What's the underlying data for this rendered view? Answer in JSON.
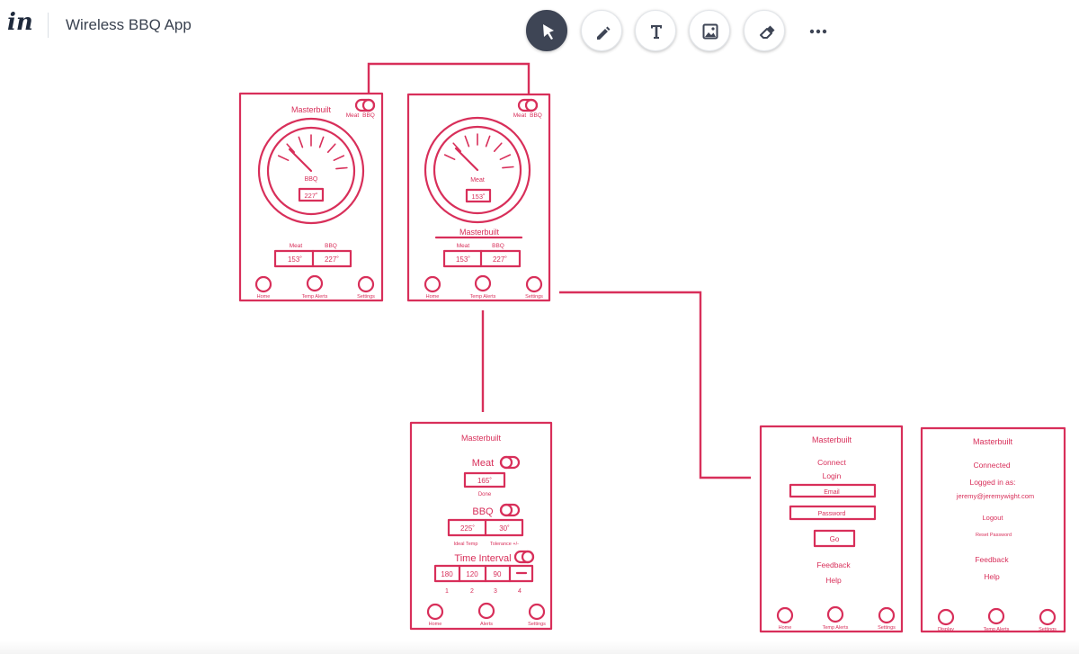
{
  "app": {
    "logo": "in",
    "title": "Wireless BBQ App"
  },
  "toolbar": [
    {
      "name": "select-tool-button",
      "icon": "cursor-arrow-icon"
    },
    {
      "name": "pen-tool-button",
      "icon": "pencil-icon"
    },
    {
      "name": "text-tool-button",
      "icon": "text-icon"
    },
    {
      "name": "image-tool-button",
      "icon": "image-icon"
    },
    {
      "name": "eraser-tool-button",
      "icon": "eraser-icon"
    },
    {
      "name": "more-options-button",
      "icon": "more-dots-icon"
    }
  ],
  "colors": {
    "wire": "#d82f5a",
    "toolbar_active": "#3e4555",
    "text": "#3a4250"
  },
  "frames": {
    "s1": {
      "brand": "Masterbuilt",
      "toggle_left": "Meat",
      "toggle_right": "BBQ",
      "gauge_label": "BBQ",
      "gauge_value": "227˚",
      "col1_label": "Meat",
      "col2_label": "BBQ",
      "col1_value": "153˚",
      "col2_value": "227˚",
      "nav": [
        "Home",
        "Temp Alerts",
        "Settings"
      ]
    },
    "s2": {
      "toggle_left": "Meat",
      "toggle_right": "BBQ",
      "gauge_label": "Meat",
      "gauge_value": "153˚",
      "brand": "Masterbuilt",
      "col1_label": "Meat",
      "col2_label": "BBQ",
      "col1_value": "153˚",
      "col2_value": "227˚",
      "nav": [
        "Home",
        "Temp Alerts",
        "Settings"
      ]
    },
    "s3": {
      "brand": "Masterbuilt",
      "meat_label": "Meat",
      "meat_value": "165˚",
      "meat_sub": "Done",
      "bbq_label": "BBQ",
      "bbq_value": "225˚",
      "bbq_tol": "30˚",
      "bbq_sub1": "Ideal Temp",
      "bbq_sub2": "Tolerance +/-",
      "interval_label": "Time Interval",
      "intervals": [
        "180",
        "120",
        "90"
      ],
      "interval_nums": [
        "1",
        "2",
        "3",
        "4"
      ],
      "nav": [
        "Home",
        "Alerts",
        "Settings"
      ]
    },
    "s4": {
      "brand": "Masterbuilt",
      "connect": "Connect",
      "login": "Login",
      "email": "Email",
      "password": "Password",
      "go": "Go",
      "feedback": "Feedback",
      "help": "Help",
      "nav": [
        "Home",
        "Temp Alerts",
        "Settings"
      ]
    },
    "s5": {
      "brand": "Masterbuilt",
      "connected": "Connected",
      "logged_in": "Logged in as:",
      "user_email": "jeremy@jeremywight.com",
      "logout": "Logout",
      "reset": "Reset Password",
      "feedback": "Feedback",
      "help": "Help",
      "nav": [
        "Display",
        "Temp Alerts",
        "Settings"
      ]
    }
  }
}
